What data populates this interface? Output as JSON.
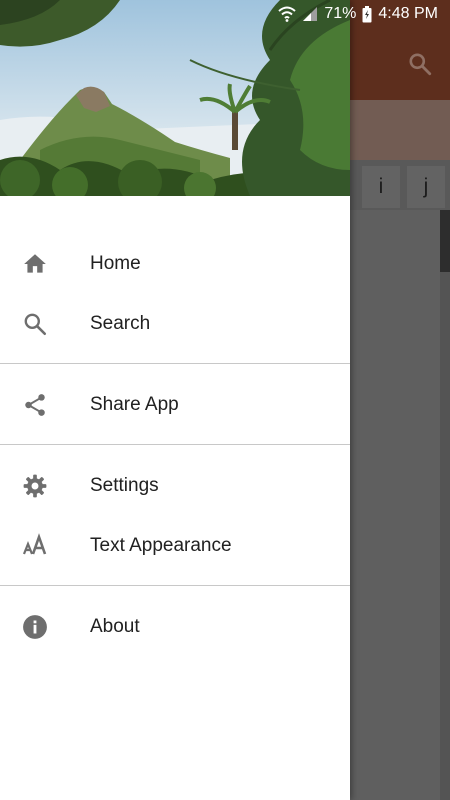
{
  "status_bar": {
    "battery": "71%",
    "time": "4:48 PM"
  },
  "background_app": {
    "letter_tabs": [
      "i",
      "j"
    ],
    "toolbar_color": "#5d2e1d"
  },
  "drawer": {
    "sections": [
      [
        {
          "label": "Home",
          "icon": "home-icon"
        },
        {
          "label": "Search",
          "icon": "search-icon"
        }
      ],
      [
        {
          "label": "Share App",
          "icon": "share-icon"
        }
      ],
      [
        {
          "label": "Settings",
          "icon": "gear-icon"
        },
        {
          "label": "Text Appearance",
          "icon": "text-size-icon"
        }
      ],
      [
        {
          "label": "About",
          "icon": "info-icon"
        }
      ]
    ]
  },
  "colors": {
    "icon_gray": "#6e6e6e",
    "text": "#212121",
    "divider": "#c8c8c8"
  }
}
